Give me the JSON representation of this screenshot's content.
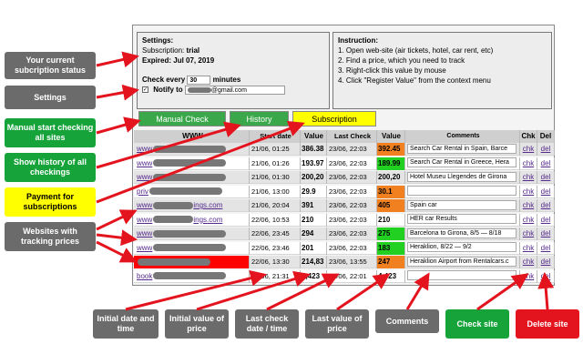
{
  "settings": {
    "title": "Settings:",
    "subscription_label": "Subscription:",
    "subscription_value": "trial",
    "expired_label": "Expired:",
    "expired_value": "Jul 07, 2019",
    "check_every_label": "Check every",
    "check_every_value": "30",
    "minutes_label": "minutes",
    "notify_label": "Notify to",
    "notify_email_suffix": "@gmail.com",
    "notify_checked": true
  },
  "instruction": {
    "title": "Instruction:",
    "steps": [
      "1. Open web-site (air tickets, hotel, car rent, etc)",
      "2. Find a price, which you need to track",
      "3. Right-click this value by mouse",
      "4. Click \"Register Value\" from the context menu"
    ]
  },
  "buttons": {
    "manual_check": "Manual Check",
    "history": "History",
    "subscription": "Subscription"
  },
  "table": {
    "headers": [
      "WWW",
      "Start date",
      "Value",
      "Last Check",
      "Value",
      "Comments",
      "Chk",
      "Del"
    ],
    "rows": [
      {
        "site": "www",
        "start": "21/06, 01:25",
        "value": "386.38",
        "last": "23/06, 22:03",
        "last_value": "392.45",
        "last_color": "#f08020",
        "comment": "Search Car Rental in Spain, Barce",
        "chk": "chk",
        "del": "del",
        "site_color": ""
      },
      {
        "site": "www",
        "start": "21/06, 01:26",
        "value": "193.97",
        "last": "23/06, 22:03",
        "last_value": "189.99",
        "last_color": "#22d022",
        "comment": "Search Car Rental in Greece, Hera",
        "chk": "chk",
        "del": "del",
        "site_color": ""
      },
      {
        "site": "www",
        "start": "21/06, 01:30",
        "value": "200,20",
        "last": "23/06, 22:03",
        "last_value": "200,20",
        "last_color": "",
        "comment": "Hotel Museu Llegendes de Girona",
        "chk": "chk",
        "del": "del",
        "site_color": ""
      },
      {
        "site": "priv",
        "start": "21/06, 13:00",
        "value": "29.9",
        "last": "23/06, 22:03",
        "last_value": "30.1",
        "last_color": "#f08020",
        "comment": "",
        "chk": "chk",
        "del": "del",
        "site_color": ""
      },
      {
        "site": "www",
        "site_suffix": "ings.com",
        "start": "21/06, 20:04",
        "value": "391",
        "last": "23/06, 22:03",
        "last_value": "405",
        "last_color": "#f08020",
        "comment": "Spain car",
        "chk": "chk",
        "del": "del",
        "site_color": ""
      },
      {
        "site": "www",
        "site_suffix": "ings.com",
        "start": "22/06, 10:53",
        "value": "210",
        "last": "23/06, 22:03",
        "last_value": "210",
        "last_color": "",
        "comment": "HER car Results",
        "chk": "chk",
        "del": "del",
        "site_color": ""
      },
      {
        "site": "www",
        "start": "22/06, 23:45",
        "value": "294",
        "last": "23/06, 22:03",
        "last_value": "275",
        "last_color": "#22d022",
        "comment": "Barcelona to Girona, 8/5 — 8/18",
        "chk": "chk",
        "del": "del",
        "site_color": ""
      },
      {
        "site": "www",
        "start": "22/06, 23:46",
        "value": "201",
        "last": "23/06, 22:03",
        "last_value": "183",
        "last_color": "#22d022",
        "comment": "Heraklion, 8/22 — 9/2",
        "chk": "chk",
        "del": "del",
        "site_color": ""
      },
      {
        "site": "",
        "start": "22/06, 13:30",
        "value": "214,83",
        "last": "23/06, 13:55",
        "last_value": "247",
        "last_color": "#f08020",
        "comment": "Heraklion Airport from Rentalcars.c",
        "chk": "chk",
        "del": "del",
        "site_color": "#ff0000"
      },
      {
        "site": "book",
        "start": "23/06, 21:31",
        "value": "4,423",
        "last": "23/06, 22:01",
        "last_value": "4,423",
        "last_color": "",
        "comment": "",
        "chk": "chk",
        "del": "del",
        "site_color": ""
      }
    ]
  },
  "callouts": {
    "subscription_status": "Your current subcription status",
    "settings": "Settings",
    "manual_start": "Manual start checking all sites",
    "show_history": "Show history of all checkings",
    "payment": "Payment for subscriptions",
    "websites": "Websites with tracking prices",
    "initial_date": "Initial date and time",
    "initial_value": "Initial value of price",
    "last_check": "Last check date / time",
    "last_value": "Last value of price",
    "comments": "Comments",
    "check_site": "Check site",
    "delete_site": "Delete site"
  },
  "colors": {
    "callout_gray": "#6b6b6b",
    "callout_green": "#16a33a",
    "callout_yellow": "#ffff00",
    "callout_red": "#e3141e",
    "arrow": "#e3141e"
  }
}
